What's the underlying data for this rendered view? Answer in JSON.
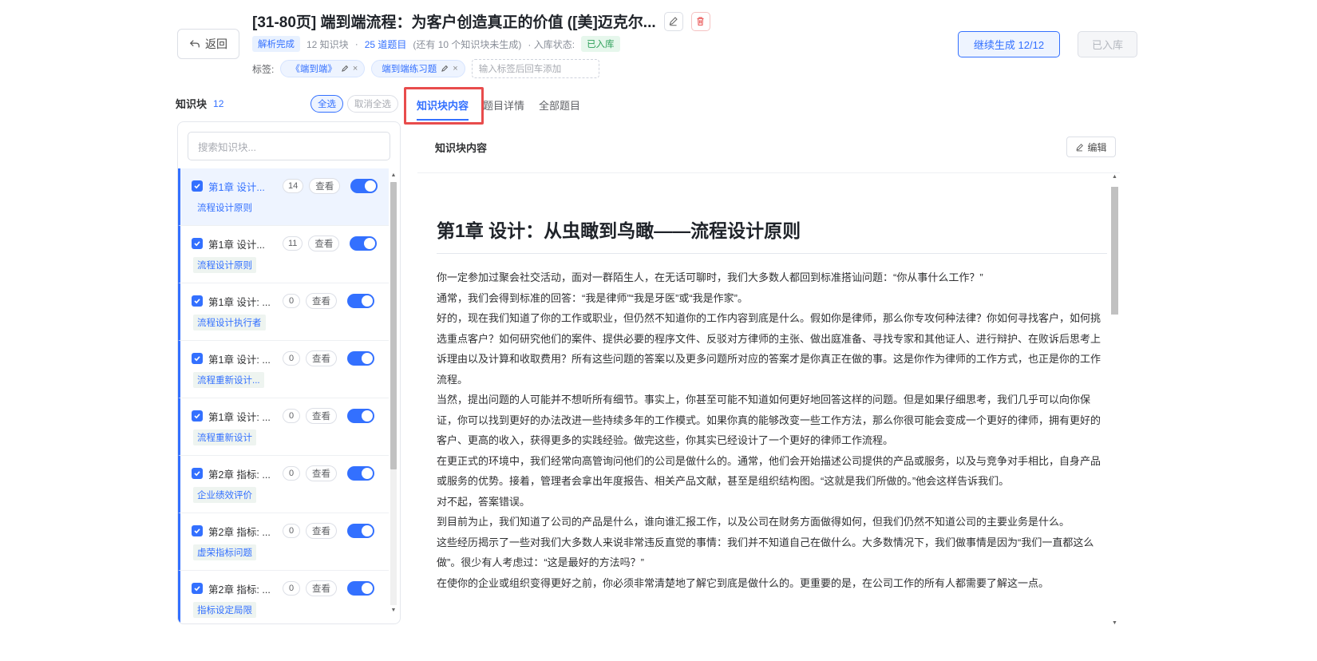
{
  "header": {
    "back_label": "返回",
    "title": "[31-80页] 端到端流程：为客户创造真正的价值 ([美]迈克尔...",
    "parse_status": "解析完成",
    "kb_count_text": "12 知识块",
    "questions_text": "25 道题目",
    "pending_text": "(还有 10 个知识块未生成)",
    "storage_label": "· 入库状态:",
    "storage_status": "已入库",
    "tags_label": "标签:",
    "tags": [
      "《端到端》",
      "端到端练习题"
    ],
    "tag_input_placeholder": "输入标签后回车添加",
    "continue_label": "继续生成 12/12",
    "stored_label": "已入库"
  },
  "left": {
    "heading": "知识块",
    "count": "12",
    "select_all": "全选",
    "deselect_all": "取消全选",
    "search_placeholder": "搜索知识块...",
    "view_label": "查看",
    "items": [
      {
        "title": "第1章 设计...",
        "count": "14",
        "tag": "流程设计原则"
      },
      {
        "title": "第1章 设计...",
        "count": "11",
        "tag": "流程设计原则"
      },
      {
        "title": "第1章 设计: ...",
        "count": "0",
        "tag": "流程设计执行者"
      },
      {
        "title": "第1章 设计: ...",
        "count": "0",
        "tag": "流程重新设计..."
      },
      {
        "title": "第1章 设计: ...",
        "count": "0",
        "tag": "流程重新设计"
      },
      {
        "title": "第2章 指标: ...",
        "count": "0",
        "tag": "企业绩效评价"
      },
      {
        "title": "第2章 指标: ...",
        "count": "0",
        "tag": "虚荣指标问题"
      },
      {
        "title": "第2章 指标: ...",
        "count": "0",
        "tag": "指标设定局限"
      }
    ]
  },
  "tabs": [
    "知识块内容",
    "题目详情",
    "全部题目"
  ],
  "content": {
    "heading": "知识块内容",
    "edit_label": "编辑",
    "article_title": "第1章 设计：从虫瞰到鸟瞰——流程设计原则",
    "paragraphs": [
      "你一定参加过聚会社交活动，面对一群陌生人，在无话可聊时，我们大多数人都回到标准搭讪问题：“你从事什么工作？”",
      "通常，我们会得到标准的回答：“我是律师”“我是牙医”或“我是作家”。",
      "好的，现在我们知道了你的工作或职业，但仍然不知道你的工作内容到底是什么。假如你是律师，那么你专攻何种法律？你如何寻找客户，如何挑选重点客户？如何研究他们的案件、提供必要的程序文件、反驳对方律师的主张、做出庭准备、寻找专家和其他证人、进行辩护、在败诉后思考上诉理由以及计算和收取费用？所有这些问题的答案以及更多问题所对应的答案才是你真正在做的事。这是你作为律师的工作方式，也正是你的工作流程。",
      "当然，提出问题的人可能并不想听所有细节。事实上，你甚至可能不知道如何更好地回答这样的问题。但是如果仔细思考，我们几乎可以向你保证，你可以找到更好的办法改进一些持续多年的工作模式。如果你真的能够改变一些工作方法，那么你很可能会变成一个更好的律师，拥有更好的客户、更高的收入，获得更多的实践经验。做完这些，你其实已经设计了一个更好的律师工作流程。",
      "在更正式的环境中，我们经常向高管询问他们的公司是做什么的。通常，他们会开始描述公司提供的产品或服务，以及与竞争对手相比，自身产品或服务的优势。接着，管理者会拿出年度报告、相关产品文献，甚至是组织结构图。“这就是我们所做的。”他会这样告诉我们。",
      "对不起，答案错误。",
      "到目前为止，我们知道了公司的产品是什么，谁向谁汇报工作，以及公司在财务方面做得如何，但我们仍然不知道公司的主要业务是什么。",
      "这些经历揭示了一些对我们大多数人来说非常违反直觉的事情：我们并不知道自己在做什么。大多数情况下，我们做事情是因为“我们一直都这么做”。很少有人考虑过：“这是最好的方法吗？”",
      "在使你的企业或组织变得更好之前，你必须非常清楚地了解它到底是做什么的。更重要的是，在公司工作的所有人都需要了解这一点。"
    ]
  },
  "colors": {
    "accent": "#3370ff",
    "danger": "#e84c4c",
    "success": "#2ea05a"
  }
}
